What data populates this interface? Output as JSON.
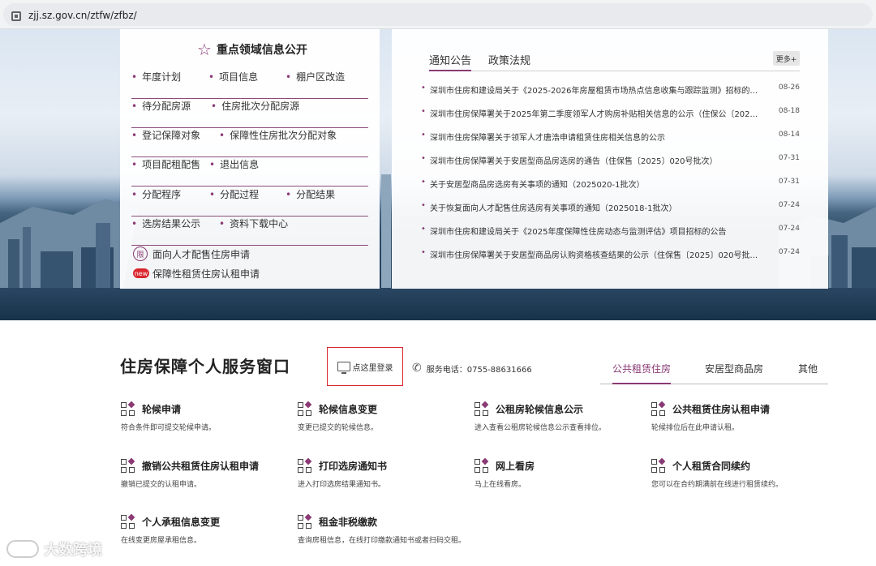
{
  "browser": {
    "url": "zjj.sz.gov.cn/ztfw/zfbz/"
  },
  "key_info": {
    "title": "重点领域信息公开",
    "rows": [
      [
        "年度计划",
        "项目信息",
        "棚户区改造"
      ],
      [
        "待分配房源",
        "住房批次分配房源"
      ],
      [
        "登记保障对象",
        "保障性住房批次分配对象"
      ],
      [
        "项目配租配售",
        "退出信息"
      ],
      [
        "分配程序",
        "分配过程",
        "分配结果"
      ],
      [
        "选房结果公示",
        "资料下载中心"
      ]
    ],
    "special_links": [
      {
        "badge": "限",
        "label": "面向人才配售住房申请"
      },
      {
        "badge": "new",
        "label": "保障性租赁住房认租申请"
      }
    ]
  },
  "news": {
    "tabs": [
      "通知公告",
      "政策法规"
    ],
    "more": "更多+",
    "items": [
      {
        "title": "深圳市住房和建设局关于《2025-2026年房屋租赁市场热点信息收集与跟踪监测》招标的...",
        "date": "08-26"
      },
      {
        "title": "深圳市住房保障署关于2025年第二季度领军人才购房补贴相关信息的公示（住保公〔202...",
        "date": "08-18"
      },
      {
        "title": "深圳市住房保障署关于领军人才唐浩申请租赁住房相关信息的公示",
        "date": "08-14"
      },
      {
        "title": "深圳市住房保障署关于安居型商品房选房的通告（住保售〔2025〕020号批次）",
        "date": "07-31"
      },
      {
        "title": "关于安居型商品房选房有关事项的通知（2025020-1批次）",
        "date": "07-31"
      },
      {
        "title": "关于恢复面向人才配售住房选房有关事项的通知（2025018-1批次）",
        "date": "07-24"
      },
      {
        "title": "深圳市住房和建设局关于《2025年度保障性住房动态与监测评估》项目招标的公告",
        "date": "07-24"
      },
      {
        "title": "深圳市住房保障署关于安居型商品房认购资格核查结果的公示（住保售〔2025〕020号批...",
        "date": "07-24"
      }
    ]
  },
  "service": {
    "title": "住房保障个人服务窗口",
    "login": "点这里登录",
    "phone": "服务电话：0755-88631666",
    "tabs": [
      "公共租赁住房",
      "安居型商品房",
      "其他"
    ],
    "items": [
      {
        "name": "轮候申请",
        "desc": "符合条件即可提交轮候申请。"
      },
      {
        "name": "轮候信息变更",
        "desc": "变更已提交的轮候信息。"
      },
      {
        "name": "公租房轮候信息公示",
        "desc": "进入查看公租房轮候信息公示查看排位。"
      },
      {
        "name": "公共租赁住房认租申请",
        "desc": "轮候排位后在此申请认租。"
      },
      {
        "name": "撤销公共租赁住房认租申请",
        "desc": "撤销已提交的认租申请。"
      },
      {
        "name": "打印选房通知书",
        "desc": "进入打印选房结果通知书。"
      },
      {
        "name": "网上看房",
        "desc": "马上在线看房。"
      },
      {
        "name": "个人租赁合同续约",
        "desc": "您可以在合约期满前在线进行租赁续约。"
      },
      {
        "name": "个人承租信息变更",
        "desc": "在线变更房屋承租信息。"
      },
      {
        "name": "租金非税缴款",
        "desc": "查询房租信息，在线打印缴款通知书或者扫码交租。"
      }
    ]
  },
  "watermark": "大数跨境"
}
